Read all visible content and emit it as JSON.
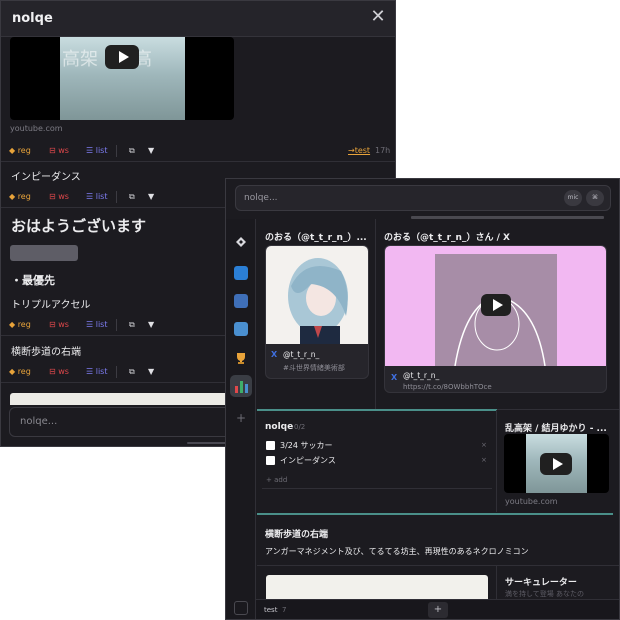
{
  "colors": {
    "background": "#1c1b20",
    "reg": "#e8a33a",
    "ws": "#e0484b",
    "list": "#7d7cf0",
    "accent_link": "#e8a33a",
    "teal": "#4a8f89"
  },
  "panel1": {
    "title": "nolqe",
    "close_icon": "close-icon",
    "video": {
      "thumb_text": "高架　乱高",
      "source": "youtube.com"
    },
    "tags": {
      "reg": "◆ reg",
      "ws": "⊟ ws",
      "list": "☰ list",
      "copy": "⧉",
      "more": "▼"
    },
    "link_label": "→test",
    "time_label": "17h",
    "items": [
      {
        "title": "インピーダンス"
      },
      {
        "heading": "おはようございます",
        "bullet": "・最優先",
        "sub": "トリプルアクセル"
      },
      {
        "title": "横断歩道の右端"
      }
    ],
    "input_placeholder": "nolqe..."
  },
  "panel2": {
    "search_placeholder": "nolqe...",
    "mic_label": "mic",
    "cmd_label": "⌘",
    "sidebar_icons": [
      "diamond-icon",
      "blue-app-icon",
      "film-icon",
      "laptop-icon",
      "trophy-icon",
      "chart-icon",
      "plus-icon",
      "grid-icon"
    ],
    "cards": {
      "twitter1": {
        "title": "のおる（@t_t_r_n_）...",
        "name": "@t_t_r_n_",
        "sub": "#斗世界情緒美術部"
      },
      "twitter2": {
        "title": "のおる（@t_t_r_n_）さん / X",
        "name": "@t_t_r_n_",
        "sub": "https://t.co/8OWbbhTOce"
      },
      "todo": {
        "title": "nolqe",
        "count": "0/2",
        "items": [
          "3/24 サッカー",
          "インピーダンス"
        ],
        "delete": "×",
        "add": "+ add"
      },
      "video": {
        "title": "乱高架 / 結月ゆかり - ...",
        "source": "youtube.com"
      },
      "note": {
        "title": "横断歩道の右端",
        "body": "アンガーマネジメント及び、てるてる坊主、再現性のあるネクロノミコン"
      },
      "circ": {
        "title": "サーキュレーター",
        "body": "満を持して登場 あなたの"
      }
    },
    "bottom": {
      "label": "test",
      "sub": "7",
      "plus": "+"
    }
  }
}
